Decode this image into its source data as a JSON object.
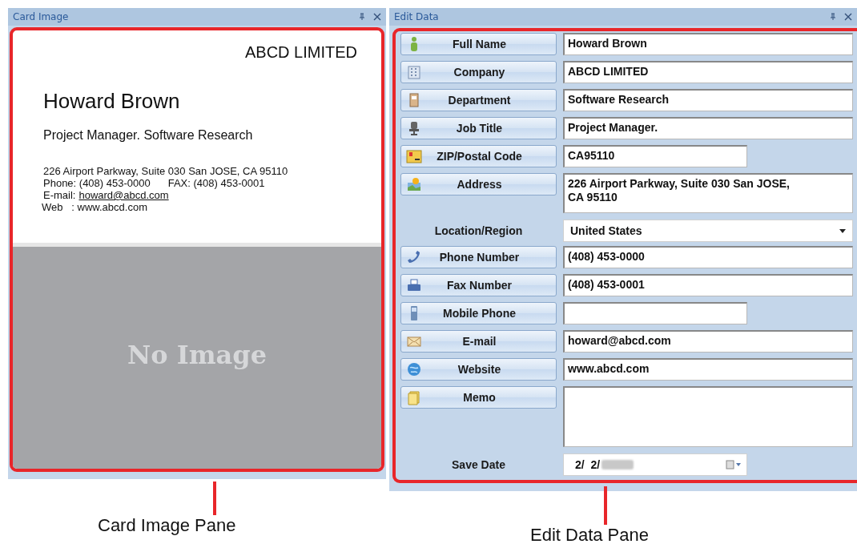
{
  "card_image_pane": {
    "title": "Card Image",
    "card": {
      "company": "ABCD LIMITED",
      "name": "Howard Brown",
      "position": "Project Manager. Software Research",
      "address": "226 Airport Parkway, Suite 030 San JOSE, CA 95110",
      "phone": "Phone: (408) 453-0000",
      "fax": "FAX: (408) 453-0001",
      "email_label": "E-mail:",
      "email": "howard@abcd.com",
      "web": "Web   : www.abcd.com"
    },
    "back_side": "No Image"
  },
  "edit_data_pane": {
    "title": "Edit Data",
    "fields": [
      {
        "label": "Full Name",
        "button": true,
        "kind": "text",
        "value": "Howard Brown"
      },
      {
        "label": "Company",
        "button": true,
        "kind": "text",
        "value": "ABCD LIMITED"
      },
      {
        "label": "Department",
        "button": true,
        "kind": "text",
        "value": "Software Research"
      },
      {
        "label": "Job Title",
        "button": true,
        "kind": "text",
        "value": "Project Manager."
      },
      {
        "label": "ZIP/Postal Code",
        "button": true,
        "kind": "short",
        "value": "CA95110"
      },
      {
        "label": "Address",
        "button": true,
        "kind": "multiline",
        "value": "226 Airport Parkway, Suite 030 San JOSE,\nCA 95110"
      },
      {
        "label": "Location/Region",
        "button": false,
        "kind": "dropdown",
        "value": "United States"
      },
      {
        "label": "Phone Number",
        "button": true,
        "kind": "text",
        "value": "(408) 453-0000"
      },
      {
        "label": "Fax Number",
        "button": true,
        "kind": "text",
        "value": "(408) 453-0001"
      },
      {
        "label": "Mobile Phone",
        "button": true,
        "kind": "short"
      },
      {
        "label": "E-mail",
        "button": true,
        "kind": "text",
        "value": "howard@abcd.com"
      },
      {
        "label": "Website",
        "button": true,
        "kind": "text",
        "value": "www.abcd.com"
      },
      {
        "label": "Memo",
        "button": true,
        "kind": "memo"
      },
      {
        "label": "Save Date",
        "button": false,
        "kind": "date",
        "value": "2/  2/"
      }
    ]
  },
  "callouts": [
    "Card Image Pane",
    "Edit Data Pane"
  ]
}
